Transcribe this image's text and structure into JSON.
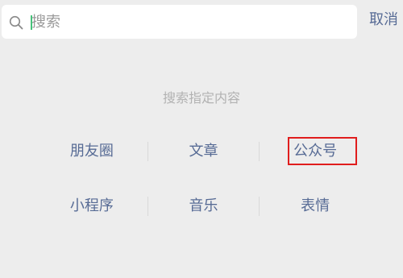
{
  "search": {
    "placeholder": "搜索",
    "value": "",
    "cancel_label": "取消"
  },
  "hint": "搜索指定内容",
  "categories": [
    [
      "朋友圈",
      "文章",
      "公众号"
    ],
    [
      "小程序",
      "音乐",
      "表情"
    ]
  ],
  "colors": {
    "background": "#ededed",
    "link": "#576b95",
    "hint_text": "#b2b2b2",
    "highlight_box": "#e01d1d",
    "cursor": "#45c27a"
  }
}
